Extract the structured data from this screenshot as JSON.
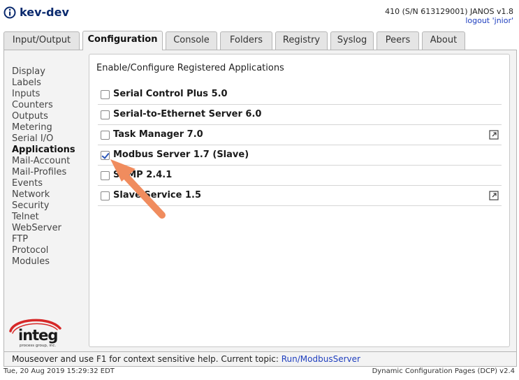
{
  "header": {
    "title": "kev-dev",
    "system_info": "410 (S/N 613129001) JANOS v1.8",
    "logout_label": "logout 'jnior'"
  },
  "tabs": [
    {
      "label": "Input/Output"
    },
    {
      "label": "Configuration",
      "active": true
    },
    {
      "label": "Console"
    },
    {
      "label": "Folders"
    },
    {
      "label": "Registry"
    },
    {
      "label": "Syslog"
    },
    {
      "label": "Peers"
    },
    {
      "label": "About"
    }
  ],
  "sidebar": {
    "items": [
      {
        "label": "Display"
      },
      {
        "label": "Labels"
      },
      {
        "label": "Inputs"
      },
      {
        "label": "Counters"
      },
      {
        "label": "Outputs"
      },
      {
        "label": "Metering"
      },
      {
        "label": "Serial I/O"
      },
      {
        "label": "Applications",
        "active": true
      },
      {
        "label": "Mail-Account"
      },
      {
        "label": "Mail-Profiles"
      },
      {
        "label": "Events"
      },
      {
        "label": "Network"
      },
      {
        "label": "Security"
      },
      {
        "label": "Telnet"
      },
      {
        "label": "WebServer"
      },
      {
        "label": "FTP"
      },
      {
        "label": "Protocol"
      },
      {
        "label": "Modules"
      }
    ]
  },
  "logo": {
    "text": "integ",
    "subtext": "process group, inc.",
    "swoosh_color": "#d62828"
  },
  "main": {
    "title": "Enable/Configure Registered Applications",
    "applications": [
      {
        "name": "Serial Control Plus 5.0",
        "checked": false,
        "launch": false
      },
      {
        "name": "Serial-to-Ethernet Server 6.0",
        "checked": false,
        "launch": false
      },
      {
        "name": "Task Manager 7.0",
        "checked": false,
        "launch": true
      },
      {
        "name": "Modbus Server 1.7 (Slave)",
        "checked": true,
        "launch": false
      },
      {
        "name": "SNMP 2.4.1",
        "checked": false,
        "launch": false
      },
      {
        "name": "Slave Service 1.5",
        "checked": false,
        "launch": true
      }
    ]
  },
  "annotation": {
    "arrow_color": "#f08c5e"
  },
  "help_bar": {
    "text": "Mouseover and use F1 for context sensitive help. Current topic: ",
    "topic": "Run/ModbusServer"
  },
  "footer": {
    "datetime": "Tue, 20 Aug 2019 15:29:32 EDT",
    "version": "Dynamic Configuration Pages (DCP) v2.4"
  },
  "colors": {
    "title": "#0a2a6e",
    "link": "#1f3fbf",
    "panel_bg": "#f3f3f3",
    "border": "#b5b5b5"
  }
}
